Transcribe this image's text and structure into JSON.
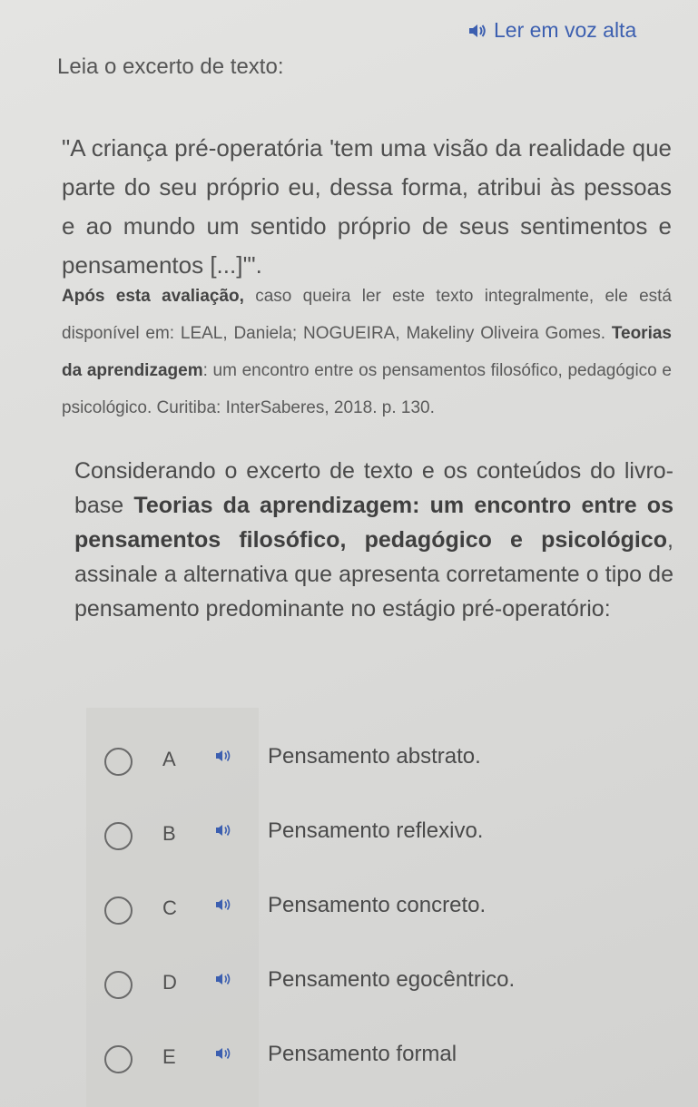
{
  "header": {
    "read_aloud_label": "Ler em voz alta",
    "read_aloud_icon": "speaker-icon"
  },
  "content": {
    "intro": "Leia o excerto de texto:",
    "quote": "\"A criança pré-operatória 'tem uma visão da realidade que parte do seu próprio eu, dessa forma, atribui às pessoas e ao mundo um sentido próprio de seus sentimentos e pensamentos [...]'\".",
    "source": {
      "lead": "Após esta avaliação,",
      "text": " caso queira ler este texto integralmente, ele está disponível em: LEAL, Daniela; NOGUEIRA, Makeliny Oliveira Gomes. ",
      "book_title": "Teorias da aprendizagem",
      "rest": ": um encontro entre os pensamentos filosófico, pedagógico e psicológico. Curitiba: InterSaberes, 2018. p. 130."
    },
    "question": {
      "before": "Considerando o excerto de texto e os conteúdos do livro-base ",
      "book_title": "Teorias da aprendizagem: um encontro entre os pensamentos filosófico, pedagógico e psicológico",
      "after": ", assinale a alternativa que apresenta corretamente o tipo de pensamento predominante no estágio pré-operatório:"
    }
  },
  "alternatives": [
    {
      "letter": "A",
      "text": "Pensamento abstrato."
    },
    {
      "letter": "B",
      "text": "Pensamento reflexivo."
    },
    {
      "letter": "C",
      "text": "Pensamento concreto."
    },
    {
      "letter": "D",
      "text": "Pensamento egocêntrico."
    },
    {
      "letter": "E",
      "text": "Pensamento formal"
    }
  ],
  "colors": {
    "link": "#3c5fb0",
    "text": "#4a4a4a",
    "background": "#dcdcda"
  }
}
